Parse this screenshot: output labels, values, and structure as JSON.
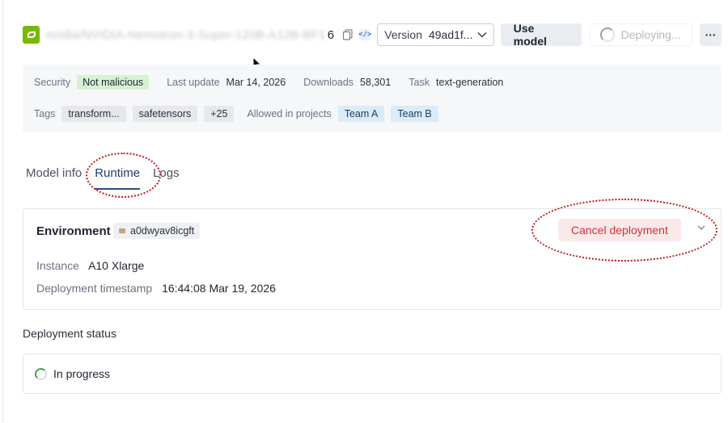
{
  "header": {
    "model_name_blurred": "nvidia/NVIDIA-Nemotron-3-Super-120B-A12B-BF1",
    "model_name_tail": "6",
    "version_label": "Version",
    "version_value": "49ad1f...",
    "use_model_label": "Use model",
    "deploying_label": "Deploying...",
    "more_label": "···"
  },
  "meta": {
    "security_label": "Security",
    "security_value": "Not malicious",
    "last_update_label": "Last update",
    "last_update_value": "Mar 14, 2026",
    "downloads_label": "Downloads",
    "downloads_value": "58,301",
    "task_label": "Task",
    "task_value": "text-generation",
    "tags_label": "Tags",
    "tags": [
      "transform...",
      "safetensors"
    ],
    "tags_more": "+25",
    "allowed_label": "Allowed in projects",
    "projects": [
      "Team A",
      "Team B"
    ]
  },
  "tabs": [
    "Model info",
    "Runtime",
    "Logs"
  ],
  "environment": {
    "title": "Environment",
    "env_id": "a0dwyav8icgft",
    "cancel_label": "Cancel deployment",
    "instance_label": "Instance",
    "instance_value": "A10 Xlarge",
    "timestamp_label": "Deployment timestamp",
    "timestamp_value": "16:44:08 Mar 19, 2026"
  },
  "deployment_status": {
    "title": "Deployment status",
    "value": "In progress"
  },
  "colors": {
    "brand_green": "#76b900",
    "annotation_red": "#c0141b",
    "danger": "#d32f2f",
    "success_badge": "#d6f2d2",
    "project_badge": "#d9ecf8"
  }
}
